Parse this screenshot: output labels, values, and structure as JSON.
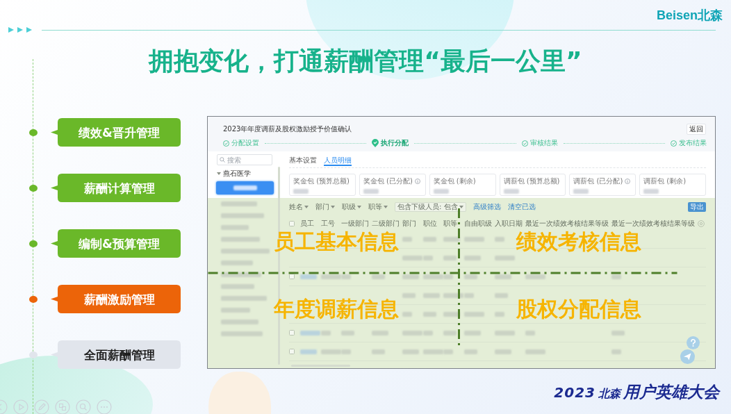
{
  "header": {
    "logo": "Beisen北森"
  },
  "title": "拥抱变化，打通薪酬管理“最后一公里”",
  "timeline": [
    {
      "label": "绩效&晋升管理",
      "color": "#6ab829"
    },
    {
      "label": "薪酬计算管理",
      "color": "#6ab829"
    },
    {
      "label": "编制&预算管理",
      "color": "#6ab829"
    },
    {
      "label": "薪酬激励管理",
      "color": "#ec6409"
    },
    {
      "label": "全面薪酬管理",
      "color": "#e1e5ec"
    }
  ],
  "app_window": {
    "title": "2023年年度调薪及股权激励授予价值确认",
    "back_button": "返回",
    "steps": [
      {
        "label": "分配设置",
        "current": false
      },
      {
        "label": "执行分配",
        "current": true
      },
      {
        "label": "审核结果",
        "current": false
      },
      {
        "label": "发布结果",
        "current": false
      }
    ],
    "search": {
      "placeholder": "搜索"
    },
    "tree": {
      "label": "燕石医学",
      "expanded": true
    },
    "tabs": [
      {
        "label": "基本设置",
        "selected": false
      },
      {
        "label": "人员明细",
        "selected": true
      }
    ],
    "summary_cards": [
      {
        "label": "奖金包 (预算总额)",
        "info": false
      },
      {
        "label": "奖金包 (已分配)",
        "info": true
      },
      {
        "label": "奖金包 (剩余)",
        "info": false
      },
      {
        "label": "调薪包 (预算总额)",
        "info": false
      },
      {
        "label": "调薪包 (已分配)",
        "info": true
      },
      {
        "label": "调薪包 (剩余)",
        "info": false
      }
    ],
    "filters": [
      {
        "label": "姓名",
        "kind": "dropdown"
      },
      {
        "label": "部门",
        "kind": "dropdown"
      },
      {
        "label": "职级",
        "kind": "dropdown"
      },
      {
        "label": "职等",
        "kind": "dropdown"
      },
      {
        "label": "包含下级人员: 包含",
        "kind": "select"
      },
      {
        "label": "高级筛选",
        "kind": "link"
      },
      {
        "label": "清空已选",
        "kind": "link"
      }
    ],
    "export_button": "导出",
    "table": {
      "columns": [
        "员工",
        "工号",
        "一级部门",
        "二级部门",
        "部门",
        "职位",
        "职等",
        "自由职级",
        "入职日期",
        "最近一次绩效考核结果等级",
        "最近一次绩效考核结果等级"
      ]
    }
  },
  "overlay": {
    "quadrants": [
      "员工基本信息",
      "绩效考核信息",
      "年度调薪信息",
      "股权分配信息"
    ]
  },
  "event_logo": {
    "year": "2023",
    "brand": "北森",
    "name": "用户英雄大会"
  }
}
